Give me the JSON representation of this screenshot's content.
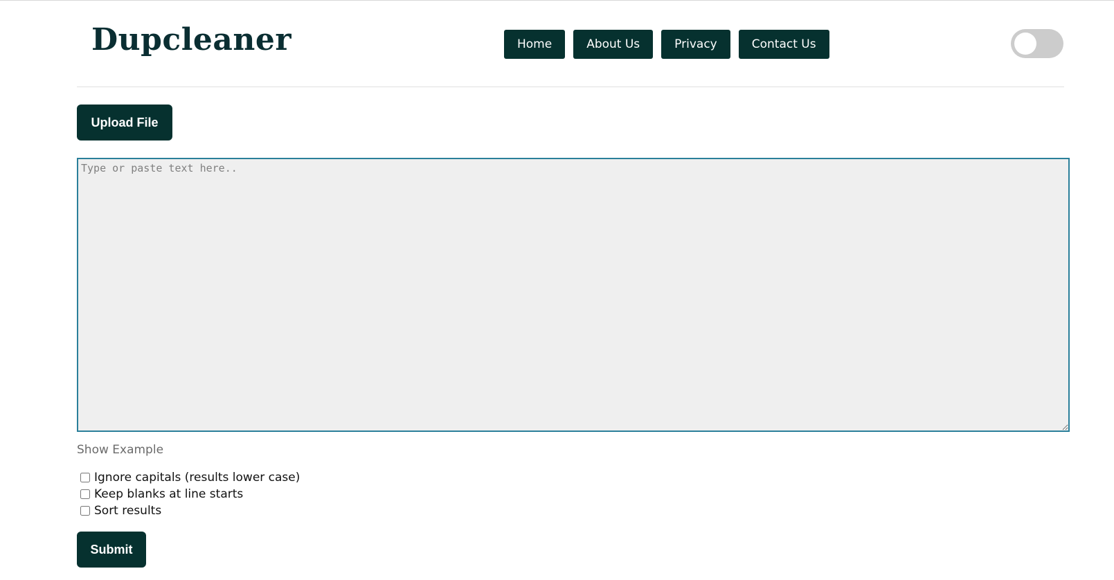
{
  "brand": {
    "logo_text": "Dupcleaner",
    "color": "#06312f"
  },
  "nav": {
    "items": [
      {
        "label": "Home"
      },
      {
        "label": "About Us"
      },
      {
        "label": "Privacy"
      },
      {
        "label": "Contact Us"
      }
    ]
  },
  "theme_toggle": {
    "state": "off"
  },
  "upload": {
    "label": "Upload File"
  },
  "editor": {
    "placeholder": "Type or paste text here..",
    "value": ""
  },
  "show_example": {
    "label": "Show Example"
  },
  "options": [
    {
      "label": "Ignore capitals (results lower case)",
      "checked": false
    },
    {
      "label": "Keep blanks at line starts",
      "checked": false
    },
    {
      "label": "Sort results",
      "checked": false
    }
  ],
  "submit": {
    "label": "Submit"
  },
  "colors": {
    "button_bg": "#06312f",
    "textarea_border": "#2a7f9a",
    "textarea_bg": "#efefef"
  }
}
